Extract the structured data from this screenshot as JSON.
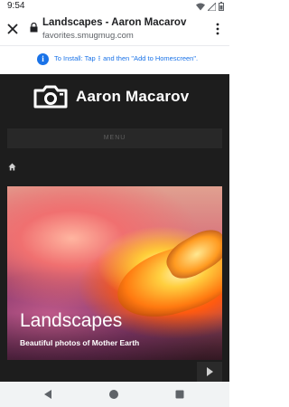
{
  "statusbar": {
    "time": "9:54"
  },
  "tab": {
    "title": "Landscapes - Aaron Macarov",
    "url": "favorites.smugmug.com"
  },
  "banner": {
    "prefix": "To Install: Tap",
    "suffix": "and then \"Add to Homescreen\".",
    "share_glyph": "⁝"
  },
  "site": {
    "brand": "Aaron Macarov",
    "menu_label": "MENU"
  },
  "hero": {
    "title": "Landscapes",
    "subtitle": "Beautiful photos of Mother Earth"
  },
  "icons": {
    "close": "close-icon",
    "lock": "lock-icon",
    "overflow": "more-vert-icon",
    "info": "info-icon",
    "camera": "camera-logo-icon",
    "home": "home-icon",
    "next": "play-next-icon",
    "nav_back": "back-triangle-icon",
    "nav_home": "home-circle-icon",
    "nav_recent": "recents-square-icon"
  },
  "colors": {
    "accent": "#1a73e8",
    "site_bg": "#1d1d1d"
  }
}
